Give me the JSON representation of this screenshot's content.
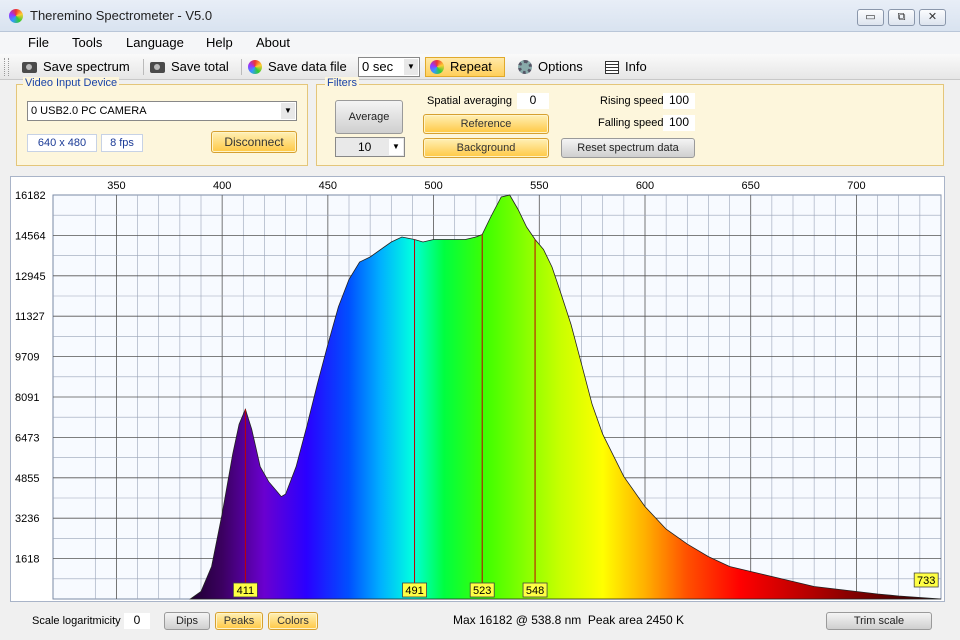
{
  "window": {
    "title": "Theremino Spectrometer - V5.0",
    "buttons": {
      "minimize": "▭",
      "restore": "⧉",
      "close": "✕"
    }
  },
  "menu": [
    "File",
    "Tools",
    "Language",
    "Help",
    "About"
  ],
  "toolbar": {
    "save_spectrum": "Save spectrum",
    "save_total": "Save total",
    "save_data_file": "Save data file",
    "interval_value": "0 sec",
    "repeat": "Repeat",
    "options": "Options",
    "info": "Info"
  },
  "video_input": {
    "label": "Video Input Device",
    "device": "0 USB2.0 PC CAMERA",
    "resolution": "640 x 480",
    "fps": "8 fps",
    "disconnect": "Disconnect"
  },
  "filters": {
    "label": "Filters",
    "average": "Average",
    "average_value": "10",
    "spatial_averaging_label": "Spatial averaging",
    "spatial_averaging_value": "0",
    "reference": "Reference",
    "background": "Background",
    "rising_speed_label": "Rising speed",
    "rising_speed_value": "100",
    "falling_speed_label": "Falling speed",
    "falling_speed_value": "100",
    "reset": "Reset spectrum data"
  },
  "bottom": {
    "scale_log_label": "Scale logaritmicity",
    "scale_log_value": "0",
    "dips": "Dips",
    "peaks": "Peaks",
    "colors": "Colors",
    "status": "Max 16182 @ 538.8 nm  Peak area 2450 K",
    "trim_scale": "Trim scale"
  },
  "colors": {
    "accent": "#ffc844",
    "plot_border": "#a9b4c8",
    "peak_line": "#c00000",
    "peak_label_bg": "#ffff44"
  },
  "chart_data": {
    "type": "area",
    "x_ticks": [
      350,
      400,
      450,
      500,
      550,
      600,
      650,
      700
    ],
    "y_ticks": [
      1618,
      3236,
      4855,
      6473,
      8091,
      9709,
      11327,
      12945,
      14564,
      16182
    ],
    "xlim": [
      320,
      740
    ],
    "ylim": [
      0,
      16182
    ],
    "grid": true,
    "x": [
      385,
      390,
      395,
      400,
      405,
      408,
      411,
      414,
      418,
      422,
      426,
      428,
      430,
      435,
      440,
      445,
      450,
      455,
      460,
      465,
      470,
      475,
      480,
      485,
      491,
      495,
      500,
      505,
      510,
      515,
      520,
      523,
      527,
      532,
      536,
      540,
      544,
      548,
      552,
      556,
      560,
      565,
      570,
      575,
      580,
      590,
      600,
      610,
      620,
      630,
      640,
      650,
      660,
      670,
      680,
      690,
      700,
      710,
      720,
      730,
      740
    ],
    "y": [
      0,
      300,
      1300,
      3400,
      5800,
      7000,
      7600,
      6800,
      5300,
      4700,
      4300,
      4100,
      4200,
      5300,
      6900,
      8600,
      10200,
      11700,
      12800,
      13500,
      13700,
      14000,
      14300,
      14500,
      14400,
      14300,
      14400,
      14400,
      14400,
      14400,
      14500,
      14600,
      15300,
      16100,
      16182,
      15600,
      14900,
      14400,
      14000,
      13300,
      12300,
      11000,
      9400,
      7800,
      6600,
      4900,
      3700,
      2800,
      2200,
      1700,
      1300,
      1100,
      900,
      700,
      500,
      400,
      300,
      200,
      120,
      60,
      0
    ],
    "peaks": [
      411,
      491,
      523,
      548,
      733
    ]
  }
}
